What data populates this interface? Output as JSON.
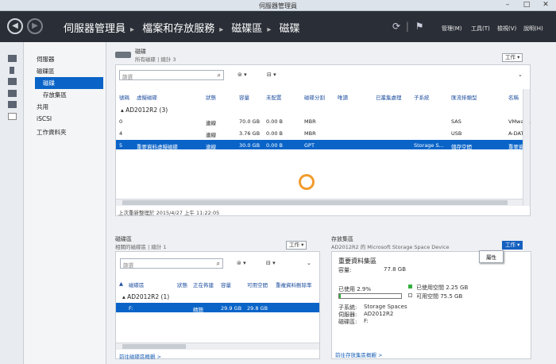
{
  "window": {
    "title": "伺服器管理員",
    "minimize": "–",
    "maximize": "□",
    "close": "✕"
  },
  "nav": {
    "breadcrumb": [
      "伺服器管理員",
      "檔案和存放服務",
      "磁碟區",
      "磁碟"
    ],
    "menus": [
      "管理(M)",
      "工具(T)",
      "檢視(V)",
      "說明(H)"
    ],
    "refresh_icon": "refresh-icon",
    "flag_icon": "flag-icon"
  },
  "tree": {
    "items": [
      "伺服器",
      "磁碟區",
      "磁碟",
      "存放集區",
      "共用",
      "iSCSI",
      "工作資料夾"
    ],
    "selected": "磁碟"
  },
  "disks": {
    "title": "磁碟",
    "subtitle": "所有磁碟 | 總計 3",
    "tasks": "工作 ▾",
    "search_placeholder": "篩選",
    "columns": [
      "號碼",
      "虛擬磁碟",
      "狀態",
      "容量",
      "未配置",
      "磁碟分割",
      "唯讀",
      "已叢集處理",
      "子系統",
      "匯流排類型",
      "名稱"
    ],
    "group": "AD2012R2 (3)",
    "rows": [
      [
        "0",
        "",
        "連線",
        "70.0 GB",
        "0.00 B",
        "MBR",
        "",
        "",
        "",
        "SAS",
        "VMware,"
      ],
      [
        "4",
        "",
        "連線",
        "3.76 GB",
        "0.00 B",
        "MBR",
        "",
        "",
        "",
        "USB",
        "A-DATA"
      ],
      [
        "5",
        "重要資料虛擬磁碟",
        "連線",
        "30.0 GB",
        "0.00 B",
        "GPT",
        "",
        "",
        "Storage S...",
        "儲存空間",
        "重要資料"
      ]
    ],
    "selected_row": 2,
    "status": "上次重新整理於 2015/4/27 上午 11:22:05"
  },
  "volumes": {
    "title": "磁碟區",
    "subtitle": "相關的磁碟區 | 總計 1",
    "tasks": "工作 ▾",
    "search_placeholder": "篩選",
    "columns": [
      "磁碟區",
      "狀態",
      "正在佈建",
      "容量",
      "可用空間",
      "重複資料刪除率"
    ],
    "group": "AD2012R2 (1)",
    "rows": [
      [
        "F:",
        "",
        "精簡",
        "29.9 GB",
        "29.8 GB",
        ""
      ]
    ],
    "link": "前往磁碟區概觀 >"
  },
  "pool": {
    "title": "存放集區",
    "subtitle": "AD2012R2 的 Microsoft Storage Space Device",
    "tasks": "工作 ▾",
    "context_item": "屬性",
    "name": "重要資料集區",
    "capacity_label": "容量:",
    "capacity": "77.8 GB",
    "used_label": "已使用 2.9%",
    "used_percent": 2.9,
    "legend_used": "已使用空間 2.25 GB",
    "legend_free": "可用空間 75.5 GB",
    "details": [
      [
        "子系統:",
        "Storage Spaces"
      ],
      [
        "伺服器:",
        "AD2012R2"
      ],
      [
        "磁碟區:",
        "F:"
      ]
    ],
    "link": "前往存放集區概觀 >"
  },
  "colors": {
    "accent": "#0a64c8",
    "nav": "#2a2f37",
    "used": "#33b040",
    "spinner": "#f29b2c"
  }
}
